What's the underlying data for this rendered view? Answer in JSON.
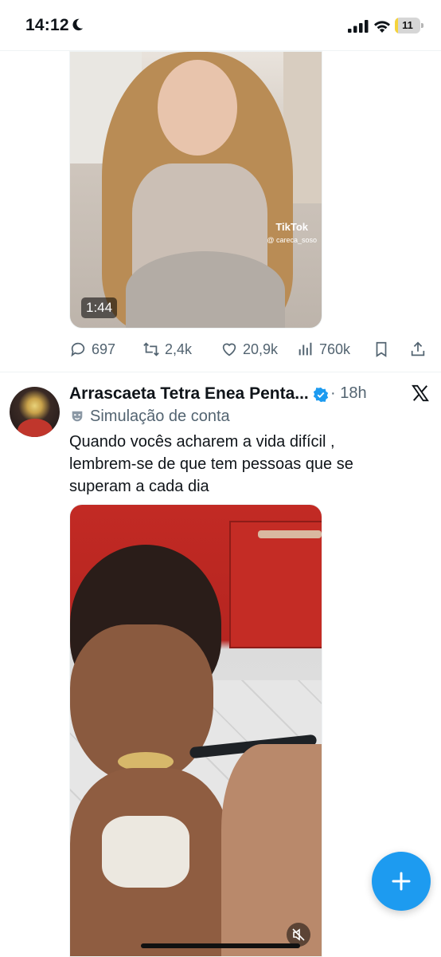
{
  "status_bar": {
    "time": "14:12",
    "battery_level": "11",
    "battery_fraction": 0.11,
    "icons": [
      "moon-icon",
      "cellular-signal-icon",
      "wifi-icon",
      "battery-icon"
    ]
  },
  "tweet1": {
    "video_duration": "1:44",
    "watermark_brand": "TikTok",
    "watermark_user": "@ careca_soso",
    "replies": "697",
    "reposts": "2,4k",
    "likes": "20,9k",
    "views": "760k"
  },
  "tweet2": {
    "author_name": "Arrascaeta Tetra Enea Penta...",
    "time": "18h",
    "separator": "·",
    "label": "Simulação de conta",
    "text": "Quando vocês acharem a vida  difícil , lembrem-se de que tem pessoas que se superam a cada dia"
  },
  "colors": {
    "accent": "#1d9bf0",
    "secondary_text": "#536471",
    "primary_text": "#0f1419"
  }
}
